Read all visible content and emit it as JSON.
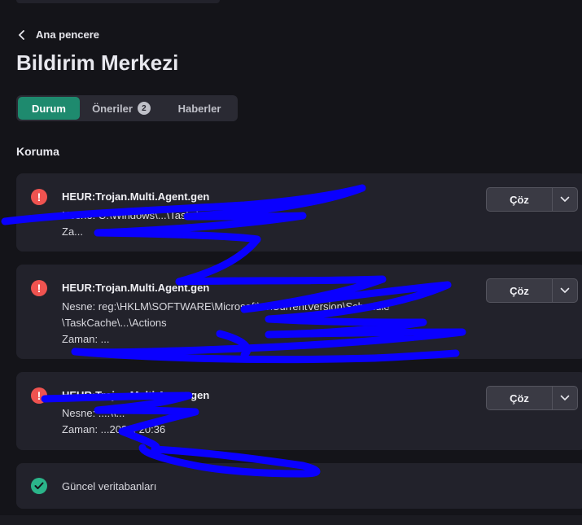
{
  "nav": {
    "back_label": "Ana pencere"
  },
  "page": {
    "title": "Bildirim Merkezi"
  },
  "tabs": [
    {
      "label": "Durum",
      "active": true
    },
    {
      "label": "Öneriler",
      "badge": "2"
    },
    {
      "label": "Haberler"
    }
  ],
  "section": {
    "title": "Koruma"
  },
  "threats": [
    {
      "name": "HEUR:Trojan.Multi.Agent.gen",
      "object_line": "Nesne: C:\\Windows\\...\\Tasks\\...",
      "time_line": "Za...",
      "action_label": "Çöz"
    },
    {
      "name": "HEUR:Trojan.Multi.Agent.gen",
      "object_line": "Nesne: reg:\\HKLM\\SOFTWARE\\Microsoft\\...\\CurrentVersion\\Schedule",
      "object_line2": "\\TaskCache\\...\\Actions",
      "time_line": "Zaman: ...",
      "action_label": "Çöz"
    },
    {
      "name": "HEUR:Trojan.Multi.Agent.gen",
      "object_line": "Nesne: ...:\\\\...",
      "time_line": "Zaman: ...202... 20:36",
      "action_label": "Çöz"
    }
  ],
  "status": {
    "label": "Güncel veritabanları"
  },
  "colors": {
    "accent": "#1e8a6e",
    "danger": "#ef5350",
    "ok": "#2bb58a",
    "redaction": "#0a00ff"
  }
}
